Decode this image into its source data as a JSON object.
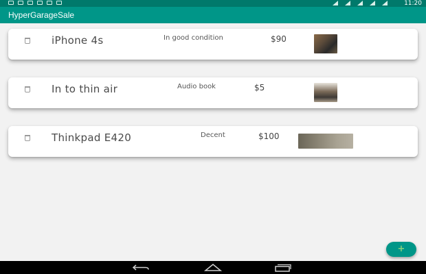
{
  "status_bar": {
    "time": "11:20",
    "left_icons": [
      "email-icon",
      "wifi-icon",
      "image-icon",
      "image-icon",
      "image-icon",
      "image-icon"
    ],
    "right_icons": [
      "bluetooth-icon",
      "mute-icon",
      "wifi-icon",
      "signal-icon",
      "battery-icon"
    ]
  },
  "app": {
    "title": "HyperGarageSale",
    "primary_color": "#009688",
    "status_bar_color": "#00796b",
    "fab_icon_color": "#8bd17c"
  },
  "items": [
    {
      "title": "iPhone 4s",
      "description": "In good condition",
      "price": "$90",
      "icon": "trash-icon"
    },
    {
      "title": "In to thin air",
      "description": "Audio book",
      "price": "$5",
      "icon": "trash-icon"
    },
    {
      "title": "Thinkpad E420",
      "description": "Decent",
      "price": "$100",
      "icon": "trash-icon"
    }
  ],
  "fab": {
    "label": "+"
  },
  "nav": {
    "buttons": [
      "back-icon",
      "home-icon",
      "recent-apps-icon"
    ]
  }
}
